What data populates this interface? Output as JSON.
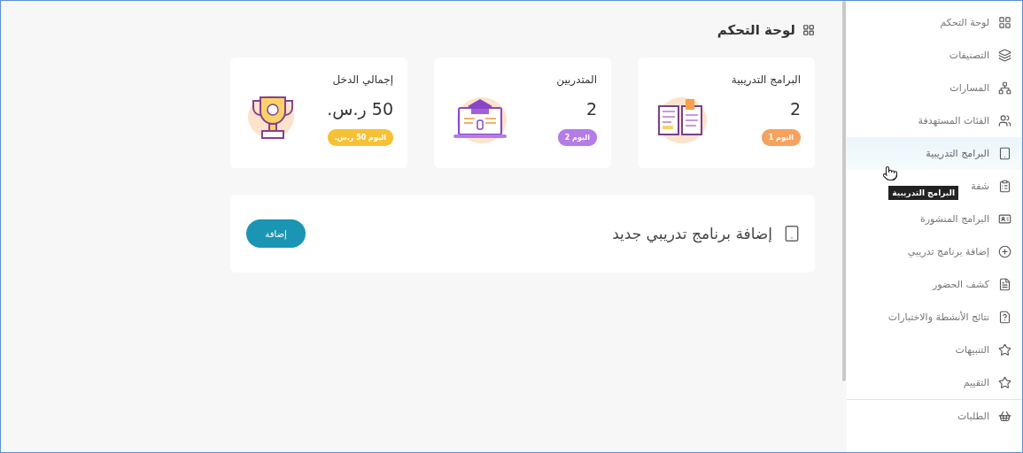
{
  "page_title": {
    "text": "لوحة التحكم"
  },
  "stats": [
    {
      "kind": "book",
      "title": "البرامج التدريبية",
      "value": "2",
      "badge": "اليوم 1",
      "color": "#f4a25e"
    },
    {
      "kind": "laptop",
      "title": "المتدربين",
      "value": "2",
      "badge": "اليوم 2",
      "color": "#b57be6"
    },
    {
      "kind": "trophy",
      "title": "إجمالي الدخل",
      "value": "50 ر.س.",
      "badge": "اليوم 50 ر.س.",
      "color": "#f6c136"
    }
  ],
  "add_panel": {
    "text": "إضافة برنامج تدريبي جديد",
    "button": "إضافة"
  },
  "sidebar": {
    "items": [
      {
        "kind": "grid",
        "label": "لوحة التحكم",
        "selected": false
      },
      {
        "kind": "layers",
        "label": "التصنيفات",
        "selected": false
      },
      {
        "kind": "network",
        "label": "المسارات",
        "selected": false
      },
      {
        "kind": "users",
        "label": "الفئات المستهدفة",
        "selected": false
      },
      {
        "kind": "tablet",
        "label": "البرامج التدريبية",
        "selected": true
      },
      {
        "kind": "clipboard",
        "label": "شفة",
        "selected": false
      },
      {
        "kind": "card",
        "label": "البرامج المنشورة",
        "selected": false
      },
      {
        "kind": "plus",
        "label": "إضافة برنامج تدريبي",
        "selected": false
      },
      {
        "kind": "file",
        "label": "كشف الحضور",
        "selected": false
      },
      {
        "kind": "question",
        "label": "نتائج الأنشطة والاختبارات",
        "selected": false
      },
      {
        "kind": "star",
        "label": "التنبيهات",
        "selected": false
      },
      {
        "kind": "star",
        "label": "التقييم",
        "selected": false
      },
      {
        "kind": "basket",
        "label": "الطلبات",
        "selected": false
      }
    ],
    "tooltip": "البرامج التدريبية"
  }
}
